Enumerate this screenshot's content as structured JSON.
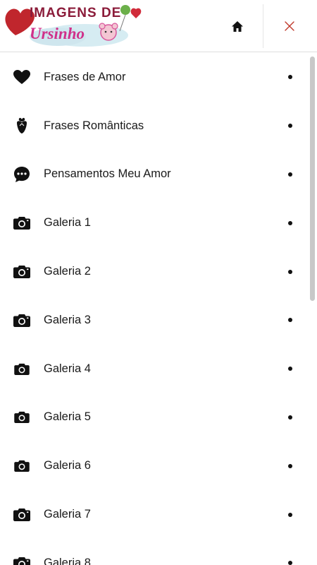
{
  "header": {
    "logo_line1": "IMAGENS DE",
    "logo_line2": "Ursinho",
    "home_icon": "home-icon",
    "close_icon": "close-icon",
    "accent_color": "#c0392b"
  },
  "menu": {
    "items": [
      {
        "label": "Frases de Amor",
        "icon": "heart-icon"
      },
      {
        "label": "Frases Românticas",
        "icon": "rose-icon"
      },
      {
        "label": "Pensamentos Meu Amor",
        "icon": "chat-bubble-icon"
      },
      {
        "label": "Galeria 1",
        "icon": "camera-icon"
      },
      {
        "label": "Galeria 2",
        "icon": "camera-icon"
      },
      {
        "label": "Galeria 3",
        "icon": "camera-icon"
      },
      {
        "label": "Galeria 4",
        "icon": "camera-icon"
      },
      {
        "label": "Galeria 5",
        "icon": "camera-icon"
      },
      {
        "label": "Galeria 6",
        "icon": "camera-icon"
      },
      {
        "label": "Galeria 7",
        "icon": "camera-icon"
      },
      {
        "label": "Galeria 8",
        "icon": "camera-icon"
      }
    ]
  }
}
